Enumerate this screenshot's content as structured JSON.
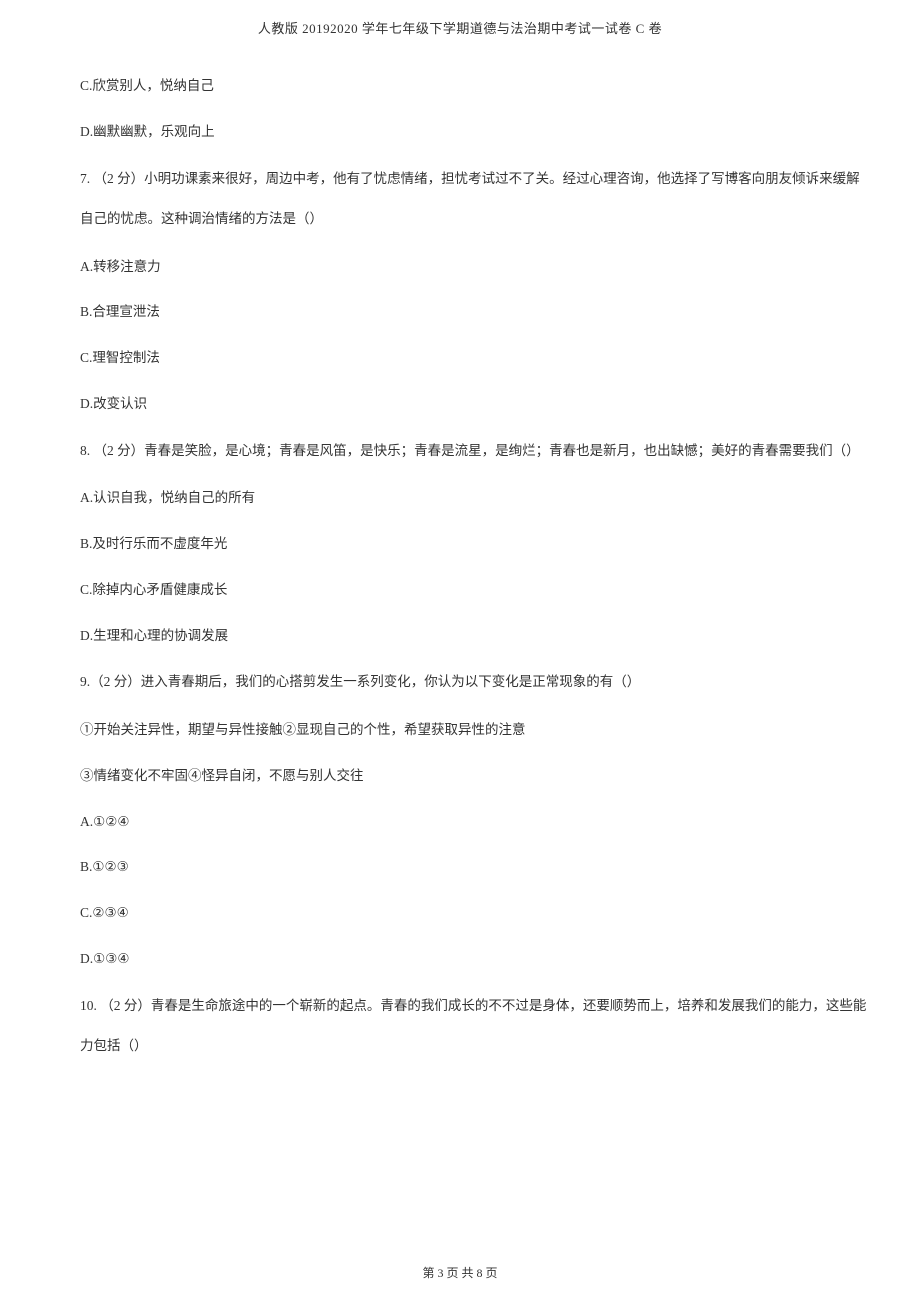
{
  "header": {
    "title": "人教版 20192020 学年七年级下学期道德与法治期中考试一试卷 C 卷"
  },
  "content": {
    "opt_6c": "C.欣赏别人，悦纳自己",
    "opt_6d": "D.幽默幽默，乐观向上",
    "q7": "7. （2 分）小明功课素来很好，周边中考，他有了忧虑情绪，担忧考试过不了关。经过心理咨询，他选择了写博客向朋友倾诉来缓解自己的忧虑。这种调治情绪的方法是（）",
    "opt_7a": "A.转移注意力",
    "opt_7b": "B.合理宣泄法",
    "opt_7c": "C.理智控制法",
    "opt_7d": "D.改变认识",
    "q8": "8. （2 分）青春是笑脸，是心境；青春是风笛，是快乐；青春是流星，是绚烂；青春也是新月，也出缺憾；美好的青春需要我们（）",
    "opt_8a": "A.认识自我，悦纳自己的所有",
    "opt_8b": "B.及时行乐而不虚度年光",
    "opt_8c": "C.除掉内心矛盾健康成长",
    "opt_8d": "D.生理和心理的协调发展",
    "q9": "9.（2 分）进入青春期后，我们的心搭剪发生一系列变化，你认为以下变化是正常现象的有（）",
    "q9_line1": "①开始关注异性，期望与异性接触②显现自己的个性，希望获取异性的注意",
    "q9_line2": "③情绪变化不牢固④怪异自闭，不愿与别人交往",
    "opt_9a": "A.①②④",
    "opt_9b": "B.①②③",
    "opt_9c": "C.②③④",
    "opt_9d": "D.①③④",
    "q10": "10. （2 分）青春是生命旅途中的一个崭新的起点。青春的我们成长的不不过是身体，还要顺势而上，培养和发展我们的能力，这些能力包括（）"
  },
  "footer": {
    "pagination": "第 3 页 共 8 页"
  }
}
